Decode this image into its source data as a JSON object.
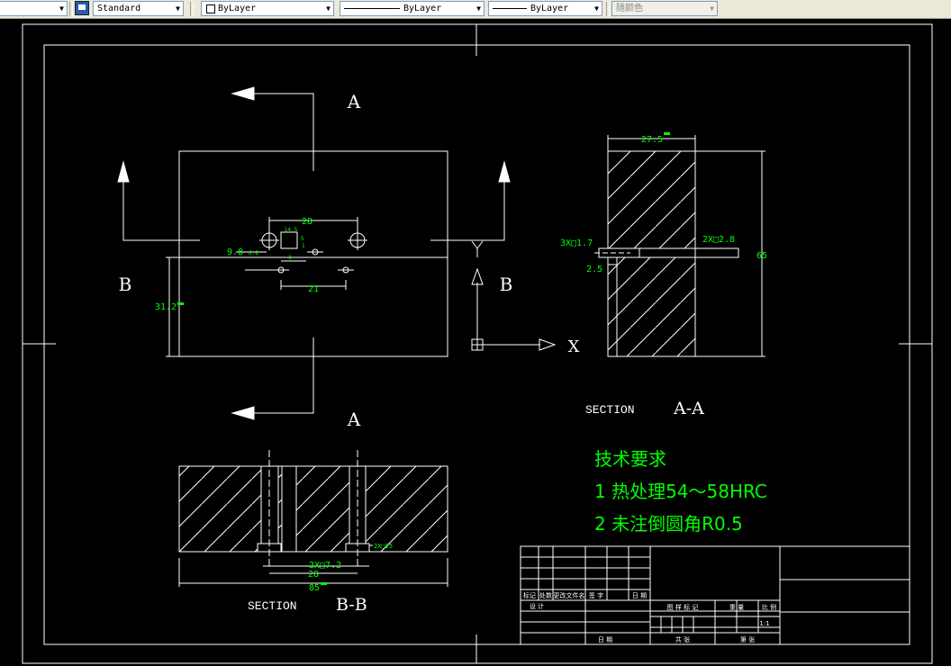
{
  "toolbar": {
    "layer_control_label": "",
    "text_style_value": "Standard",
    "color_value": "ByLayer",
    "linetype_value": "ByLayer",
    "lineweight_value": "ByLayer",
    "plotstyle_value": "随颜色",
    "icons": [
      "dropdown-arrow-icon",
      "text-style-icon",
      "color-swatch-icon",
      "linetype-glyph-icon",
      "lineweight-glyph-icon"
    ]
  },
  "drawing": {
    "colors": {
      "background": "#000000",
      "lines": "#ffffff",
      "dimensions": "#00ff00"
    },
    "section_a_top_label": "A",
    "section_a_bottom_label": "A",
    "section_b_left_label": "B",
    "section_b_right_label": "B",
    "ucs_x_label": "X",
    "view_a_title": "SECTION",
    "view_a_name": "A-A",
    "view_b_title": "SECTION",
    "view_b_name": "B-B",
    "dims": {
      "dim_28_top": "28",
      "dim_14_5": "14.5",
      "dim_9_8": "9.8",
      "dim_6_8": "6.8",
      "dim_5": "5",
      "dim_1": "1",
      "dim_3": "3",
      "dim_21": "21",
      "dim_31_2": "31.2",
      "dim_27_5": "27.5",
      "dim_3x17": "3X□1.7",
      "dim_2x28": "2X□2.8",
      "dim_2_5": "2.5",
      "dim_65": "65",
      "dim_2x72": "2X□7.2",
      "dim_28_bottom": "28",
      "dim_85": "85",
      "dim_2x25": "2X□25"
    },
    "tech_requirements": {
      "title": "技术要求",
      "item1": "1 热处理54～58HRC",
      "item2": "2 未注倒圆角R0.5"
    },
    "title_block": {
      "h_mark": "标记",
      "h_count": "处数",
      "h_doc": "更改文件名",
      "h_sign": "签 字",
      "h_date": "日 期",
      "design": "设 计",
      "stage_mark": "图 样 标 记",
      "weight": "重 量",
      "scale": "比 例",
      "scale_value": "1:1",
      "date": "日 期",
      "total": "共    张",
      "sheet": "第    张"
    }
  }
}
